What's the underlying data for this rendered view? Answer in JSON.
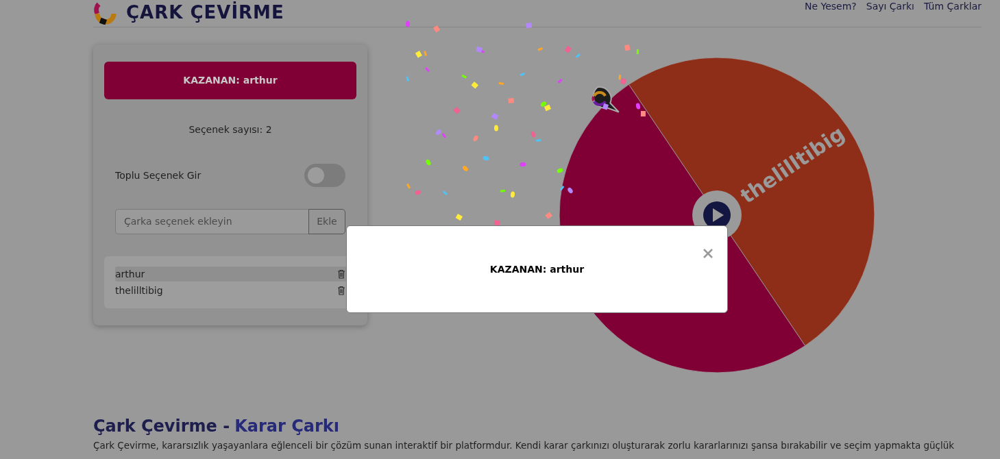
{
  "header": {
    "title": "ÇARK ÇEVİRME",
    "nav": [
      "Ne Yesem?",
      "Sayı Çarkı",
      "Tüm Çarklar"
    ]
  },
  "panel": {
    "winner_banner": "KAZANAN: arthur",
    "option_count": "Seçenek sayısı: 2",
    "bulk_toggle": {
      "label": "Toplu Seçenek Gir",
      "on": false
    },
    "add_field": {
      "placeholder": "Çarka seçenek ekleyin",
      "button": "Ekle"
    },
    "options": [
      {
        "label": "arthur",
        "selected": true
      },
      {
        "label": "thelilltibig",
        "selected": false
      }
    ]
  },
  "wheel": {
    "segments": [
      {
        "label": "thelilltibig",
        "color": "#8e2e18"
      },
      {
        "color": "#800035"
      }
    ]
  },
  "modal": {
    "message": "KAZANAN: arthur"
  },
  "article": {
    "title": "Çark Çevirme -",
    "title_accent": "Karar Çarkı",
    "paragraph": "Çark Çevirme, kararsızlık yaşayanlara eğlenceli bir çözüm sunan interaktif bir platformdur. Kendi karar çarkınızı oluşturarak zorlu kararlarınızı şansa bırakabilir ve seçim yapmakta güçlük"
  }
}
